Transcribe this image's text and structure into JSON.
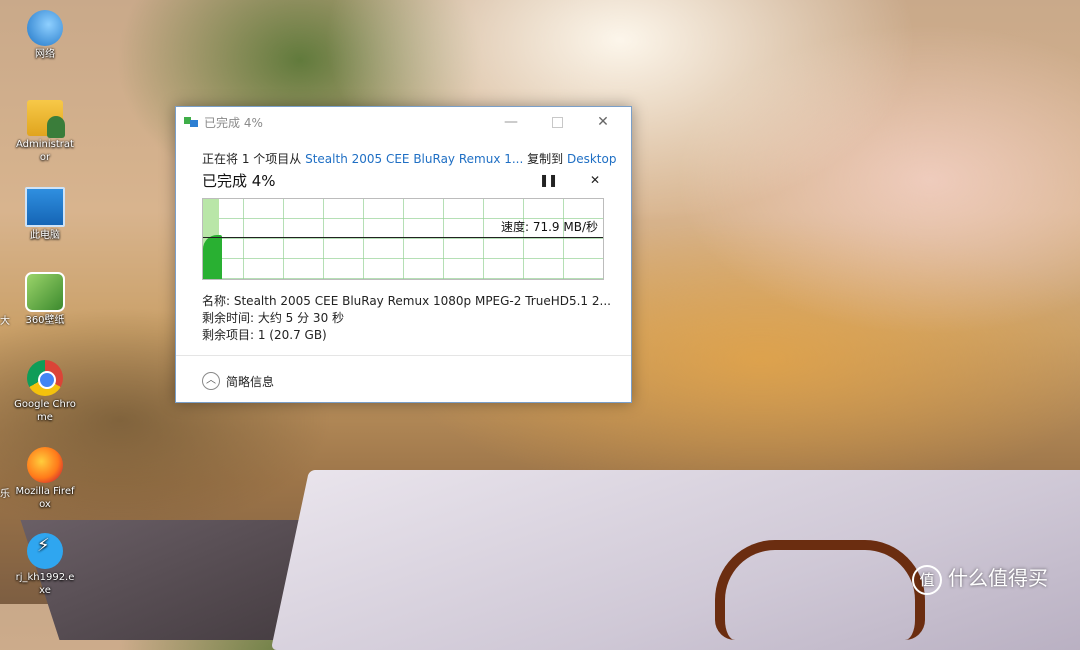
{
  "desktop": {
    "icons": [
      {
        "label": "网络",
        "icon": "network-icon"
      },
      {
        "label": "Administrator",
        "icon": "user-folder-icon"
      },
      {
        "label": "此电脑",
        "icon": "computer-icon"
      },
      {
        "label": "360壁纸",
        "icon": "360-wallpaper-icon"
      },
      {
        "label": "Google Chrome",
        "icon": "chrome-icon"
      },
      {
        "label": "Mozilla Firefox",
        "icon": "firefox-icon"
      },
      {
        "label": "rj_kh1992.exe",
        "icon": "paw-app-icon"
      }
    ],
    "edge_chars": [
      "大",
      "乐"
    ]
  },
  "dialog": {
    "title": "已完成 4%",
    "copy_prefix": "正在将 1 个项目从 ",
    "source": "Stealth 2005 CEE BluRay Remux 1...",
    "copy_mid": " 复制到 ",
    "destination": "Desktop",
    "progress_label": "已完成 4%",
    "progress_percent": 4,
    "speed": "速度: 71.9 MB/秒",
    "name": "名称:  Stealth 2005 CEE BluRay Remux 1080p MPEG-2 TrueHD5.1 2...",
    "time_remaining": "剩余时间:  大约 5 分 30 秒",
    "items_remaining": "剩余项目:  1 (20.7 GB)",
    "details_toggle": "简略信息",
    "buttons": {
      "minimize": "—",
      "close": "✕",
      "pause": "❚❚",
      "stop": "✕",
      "expander": "︿"
    }
  },
  "watermark": {
    "badge": "值",
    "text": "什么值得买"
  }
}
